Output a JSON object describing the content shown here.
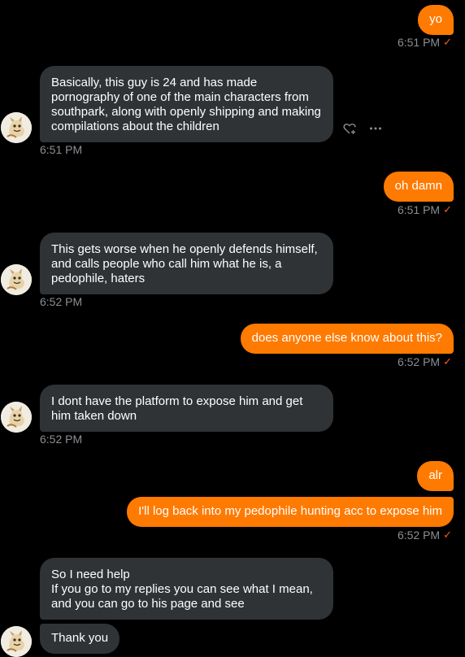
{
  "messages": [
    {
      "id": "m1",
      "from": "me",
      "text": "yo",
      "time": "6:51 PM"
    },
    {
      "id": "m2",
      "from": "them",
      "text": "Basically, this guy is 24 and has made pornography of one of the main characters from southpark, along with openly shipping and making compilations about the children",
      "time": "6:51 PM"
    },
    {
      "id": "m3",
      "from": "me",
      "text": "oh damn",
      "time": "6:51 PM"
    },
    {
      "id": "m4",
      "from": "them",
      "text": "This gets worse when he openly defends himself, and calls people who call him what he is, a pedophile, haters",
      "time": "6:52 PM"
    },
    {
      "id": "m5",
      "from": "me",
      "text": "does anyone else know about this?",
      "time": "6:52 PM"
    },
    {
      "id": "m6",
      "from": "them",
      "text": "I dont have the platform to expose him and get him taken down",
      "time": "6:52 PM"
    },
    {
      "id": "m7",
      "from": "me",
      "text": "alr",
      "time": ""
    },
    {
      "id": "m8",
      "from": "me",
      "text": "I'll log back into my pedophile hunting acc to expose him",
      "time": "6:52 PM"
    },
    {
      "id": "m9",
      "from": "them",
      "text": "So I need help\nIf you go to my replies you can see what I mean, and you can go to his page and see",
      "time": ""
    },
    {
      "id": "m10",
      "from": "them",
      "text": "Thank you",
      "time": ""
    }
  ],
  "icons": {
    "read_receipt": "check-icon",
    "react": "heart-plus-icon",
    "more": "more-horizontal-icon",
    "avatar": "avatar-image"
  },
  "colors": {
    "background": "#000000",
    "sent_bubble": "#ff7a00",
    "received_bubble": "#2f3336",
    "timestamp": "#8b8f94",
    "read_check": "#ff5722"
  }
}
